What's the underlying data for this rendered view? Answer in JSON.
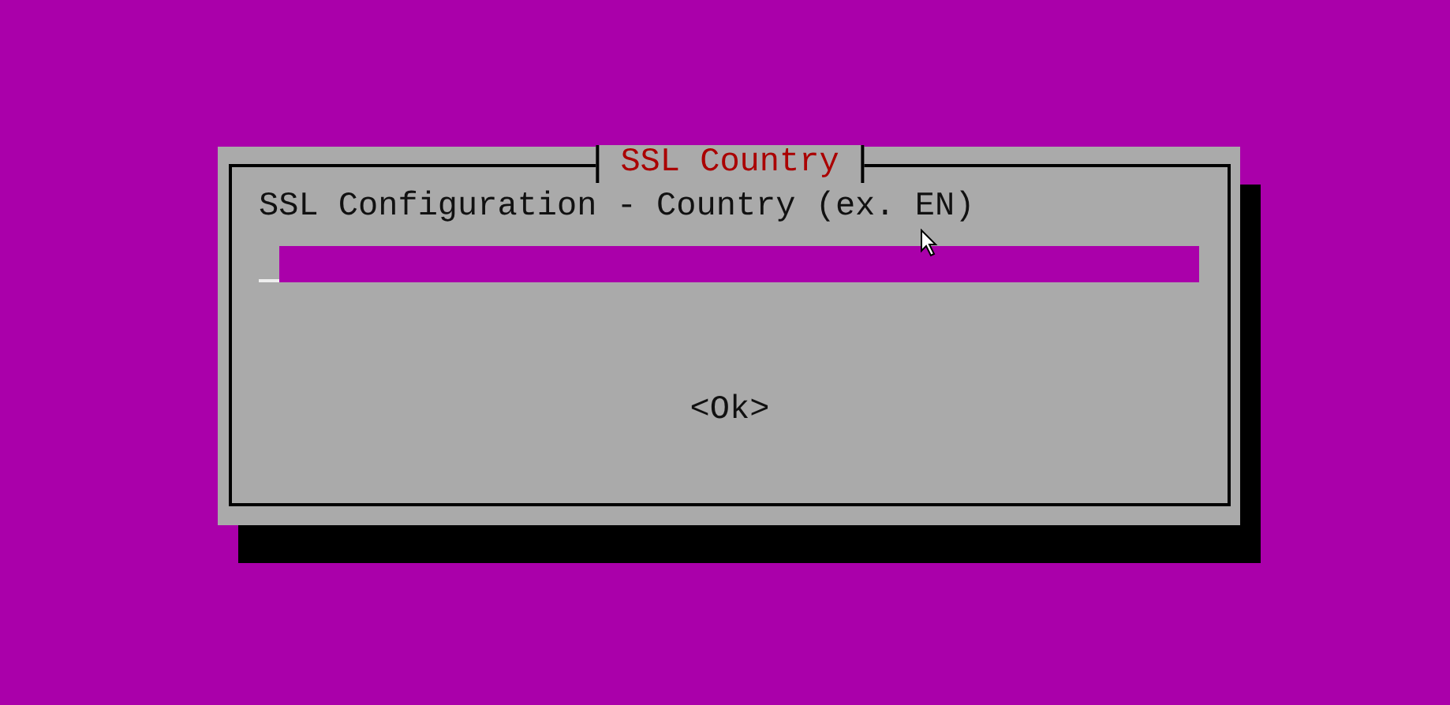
{
  "dialog": {
    "title": "SSL Country",
    "prompt": "SSL Configuration - Country (ex. EN)",
    "input": {
      "focused": true
    },
    "buttons": [
      {
        "label": "<Ok>",
        "selected": false
      }
    ]
  }
}
